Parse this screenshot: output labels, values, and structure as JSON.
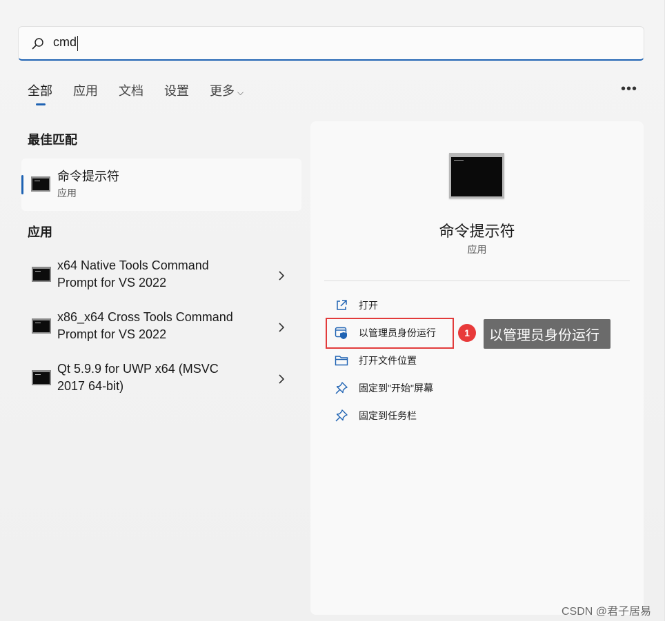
{
  "search": {
    "query": "cmd"
  },
  "tabs": [
    {
      "label": "全部"
    },
    {
      "label": "应用"
    },
    {
      "label": "文档"
    },
    {
      "label": "设置"
    },
    {
      "label": "更多"
    }
  ],
  "best_match": {
    "heading": "最佳匹配",
    "title": "命令提示符",
    "subtitle": "应用"
  },
  "apps": {
    "heading": "应用",
    "items": [
      {
        "line1": "x64 Native Tools Command",
        "line2": "Prompt for VS 2022"
      },
      {
        "line1": "x86_x64 Cross Tools Command",
        "line2": "Prompt for VS 2022"
      },
      {
        "line1": "Qt 5.9.9 for UWP x64 (MSVC",
        "line2": "2017 64-bit)"
      }
    ]
  },
  "detail": {
    "name": "命令提示符",
    "kind": "应用",
    "actions": [
      {
        "label": "打开",
        "icon": "open-external-icon"
      },
      {
        "label": "以管理员身份运行",
        "icon": "shield-icon"
      },
      {
        "label": "打开文件位置",
        "icon": "folder-icon"
      },
      {
        "label": "固定到\"开始\"屏幕",
        "icon": "pin-icon"
      },
      {
        "label": "固定到任务栏",
        "icon": "pin-icon"
      }
    ]
  },
  "annotation": {
    "badge": "1",
    "tooltip": "以管理员身份运行",
    "color": "#e23b3b"
  },
  "watermark": "CSDN @君子居易",
  "colors": {
    "accent": "#1f63b3"
  }
}
